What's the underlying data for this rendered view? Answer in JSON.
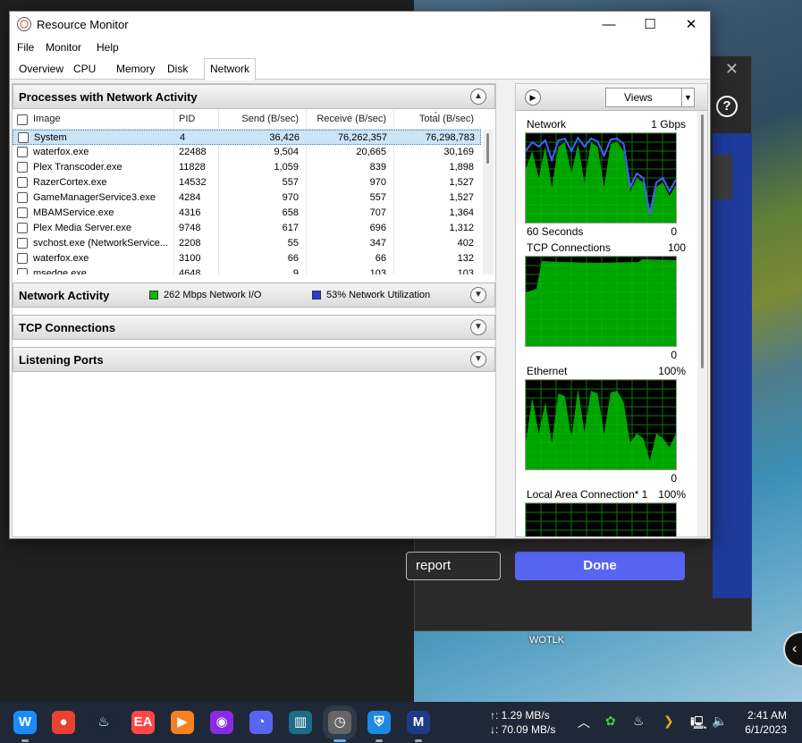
{
  "desktop": {
    "label": "WOTLK"
  },
  "background_dialog": {
    "report_label": "report",
    "done_label": "Done",
    "help_glyph": "?",
    "close_glyph": "✕"
  },
  "window": {
    "title": "Resource Monitor",
    "min_glyph": "—",
    "max_glyph": "☐",
    "close_glyph": "✕"
  },
  "menu": [
    "File",
    "Monitor",
    "Help"
  ],
  "tabs": [
    "Overview",
    "CPU",
    "Memory",
    "Disk",
    "Network"
  ],
  "active_tab": "Network",
  "processes": {
    "title": "Processes with Network Activity",
    "columns": [
      "Image",
      "PID",
      "Send (B/sec)",
      "Receive (B/sec)",
      "Total (B/sec)"
    ],
    "rows": [
      {
        "image": "System",
        "pid": "4",
        "send": "36,426",
        "receive": "76,262,357",
        "total": "76,298,783"
      },
      {
        "image": "waterfox.exe",
        "pid": "22488",
        "send": "9,504",
        "receive": "20,665",
        "total": "30,169"
      },
      {
        "image": "Plex Transcoder.exe",
        "pid": "11828",
        "send": "1,059",
        "receive": "839",
        "total": "1,898"
      },
      {
        "image": "RazerCortex.exe",
        "pid": "14532",
        "send": "557",
        "receive": "970",
        "total": "1,527"
      },
      {
        "image": "GameManagerService3.exe",
        "pid": "4284",
        "send": "970",
        "receive": "557",
        "total": "1,527"
      },
      {
        "image": "MBAMService.exe",
        "pid": "4316",
        "send": "658",
        "receive": "707",
        "total": "1,364"
      },
      {
        "image": "Plex Media Server.exe",
        "pid": "9748",
        "send": "617",
        "receive": "696",
        "total": "1,312"
      },
      {
        "image": "svchost.exe (NetworkService...",
        "pid": "2208",
        "send": "55",
        "receive": "347",
        "total": "402"
      },
      {
        "image": "waterfox.exe",
        "pid": "3100",
        "send": "66",
        "receive": "66",
        "total": "132"
      },
      {
        "image": "msedge.exe",
        "pid": "4648",
        "send": "9",
        "receive": "103",
        "total": "103"
      }
    ]
  },
  "network_activity": {
    "title": "Network Activity",
    "io_label": "262 Mbps Network I/O",
    "util_label": "53% Network Utilization",
    "io_color": "#00c000",
    "util_color": "#1f3fd0"
  },
  "tcp_connections": {
    "title": "TCP Connections"
  },
  "listening_ports": {
    "title": "Listening Ports"
  },
  "right_pane": {
    "views_label": "Views",
    "graphs": [
      {
        "title": "Network",
        "max": "1 Gbps",
        "bottom_left": "60 Seconds",
        "bottom_right": "0"
      },
      {
        "title": "TCP Connections",
        "max": "100",
        "bottom_left": "",
        "bottom_right": "0"
      },
      {
        "title": "Ethernet",
        "max": "100%",
        "bottom_left": "",
        "bottom_right": "0"
      },
      {
        "title": "Local Area Connection* 1",
        "max": "100%",
        "bottom_left": "",
        "bottom_right": ""
      }
    ],
    "graph_colors": {
      "fill": "#00c000",
      "line": "#4060ff",
      "grid": "#0a7a0a"
    }
  },
  "taskbar": {
    "apps": [
      {
        "name": "waterfox-icon",
        "glyph": "W",
        "color": "#1a8cff"
      },
      {
        "name": "chrome-icon",
        "glyph": "●",
        "color": "#e94235"
      },
      {
        "name": "steam-icon",
        "glyph": "♨",
        "color": "#1b2838"
      },
      {
        "name": "ea-icon",
        "glyph": "EA",
        "color": "#ff4747"
      },
      {
        "name": "player-icon",
        "glyph": "▶",
        "color": "#f58220"
      },
      {
        "name": "disc-player-icon",
        "glyph": "◉",
        "color": "#8a2be2"
      },
      {
        "name": "discord-icon",
        "glyph": "◔",
        "color": "#5865f2"
      },
      {
        "name": "app-panel-icon",
        "glyph": "▥",
        "color": "#1e6b8a"
      },
      {
        "name": "resource-monitor-icon",
        "glyph": "◷",
        "color": "#666666"
      },
      {
        "name": "defender-icon",
        "glyph": "⛨",
        "color": "#1e88e5"
      },
      {
        "name": "malwarebytes-icon",
        "glyph": "M",
        "color": "#1e3a8a"
      }
    ],
    "upload_speed": "↑: 1.29 MB/s",
    "download_speed": "↓: 70.09 MB/s",
    "time": "2:41 AM",
    "date": "6/1/2023"
  }
}
